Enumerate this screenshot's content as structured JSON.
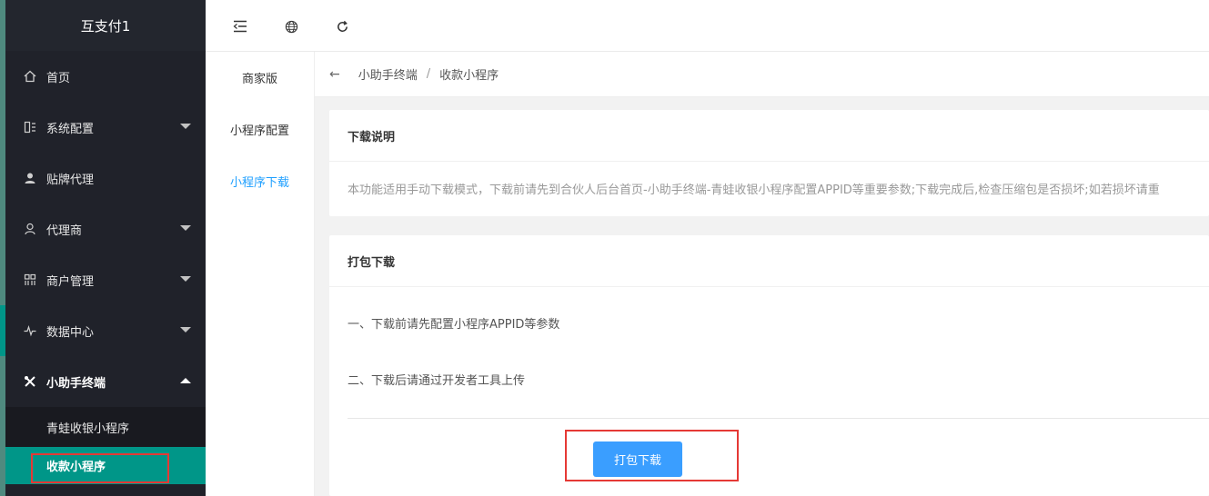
{
  "app": {
    "title": "互支付1"
  },
  "sidebar": {
    "items": [
      {
        "label": "首页",
        "icon": "home-icon"
      },
      {
        "label": "系统配置",
        "icon": "settings-icon"
      },
      {
        "label": "贴牌代理",
        "icon": "user-icon"
      },
      {
        "label": "代理商",
        "icon": "person-icon"
      },
      {
        "label": "商户管理",
        "icon": "grid-icon"
      },
      {
        "label": "数据中心",
        "icon": "pulse-icon"
      },
      {
        "label": "小助手终端",
        "icon": "tools-icon"
      }
    ],
    "sub_items": [
      {
        "label": "青蛙收银小程序"
      },
      {
        "label": "收款小程序"
      }
    ]
  },
  "header": {
    "icons": [
      "menu-fold-icon",
      "globe-icon",
      "refresh-icon"
    ]
  },
  "subnav": {
    "items": [
      {
        "label": "商家版"
      },
      {
        "label": "小程序配置"
      },
      {
        "label": "小程序下载"
      }
    ]
  },
  "breadcrumb": {
    "items": [
      "小助手终端",
      "收款小程序"
    ],
    "separator": "/"
  },
  "download_note": {
    "title": "下载说明",
    "text": "本功能适用手动下载模式，下载前请先到合伙人后台首页-小助手终端-青蛙收银小程序配置APPID等重要参数;下载完成后,检查压缩包是否损坏;如若损坏请重"
  },
  "package": {
    "title": "打包下载",
    "step1": "一、下载前请先配置小程序APPID等参数",
    "step2": "二、下载后请通过开发者工具上传",
    "button_label": "打包下载"
  },
  "colors": {
    "sidebar_bg": "#20222a",
    "accent": "#009688",
    "primary_button": "#3a9eff",
    "link_active": "#1e9fff",
    "highlight_box": "#e53935"
  }
}
